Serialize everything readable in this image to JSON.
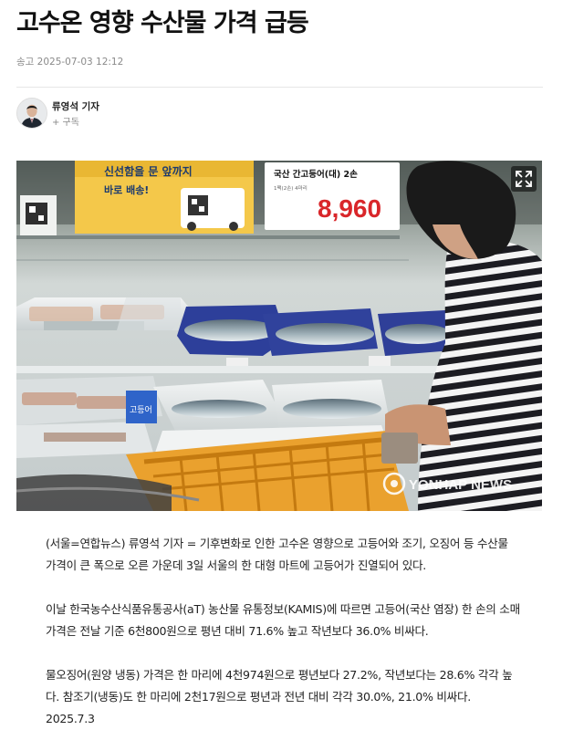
{
  "headline": "고수온 영향 수산물 가격 급등",
  "meta": {
    "label": "송고",
    "datetime": "2025-07-03 12:12"
  },
  "reporter": {
    "name": "류영석 기자",
    "subscribe_label": "+ 구독"
  },
  "photo": {
    "price_card_title": "국산 간고등어(대) 2손",
    "price_card_sub": "1팩(2손) 4마리",
    "price_card_price": "8,960",
    "delivery_banner_line1": "신선함을 문 앞까지",
    "delivery_banner_line2": "바로 배송!",
    "sign_blue": "고등어",
    "watermark": "YONHAP NEWS"
  },
  "article": {
    "p1": "(서울=연합뉴스) 류영석 기자 = 기후변화로 인한 고수온 영향으로 고등어와 조기, 오징어 등 수산물 가격이 큰 폭으로 오른 가운데 3일 서울의 한 대형 마트에 고등어가 진열되어 있다.",
    "p2": "이날 한국농수산식품유통공사(aT) 농산물 유통정보(KAMIS)에 따르면 고등어(국산 염장) 한 손의 소매가격은 전날 기준 6천800원으로 평년 대비 71.6% 높고 작년보다 36.0% 비싸다.",
    "p3": "물오징어(원양 냉동) 가격은 한 마리에 4천974원으로 평년보다 27.2%, 작년보다는 28.6% 각각 높다. 참조기(냉동)도 한 마리에 2천17원으로 평년과 전년 대비 각각 30.0%, 21.0% 비싸다.",
    "date": "2025.7.3"
  }
}
